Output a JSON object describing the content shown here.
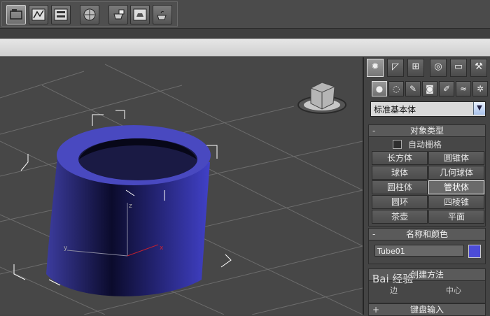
{
  "toolbar": {
    "buttons": [
      "layer-manager",
      "curve-editor",
      "render-to-texture",
      "material-editor",
      "render-setup",
      "rendered-frame-window",
      "render-production"
    ]
  },
  "panel": {
    "tabs": [
      "create",
      "modify",
      "hierarchy",
      "motion",
      "display",
      "utilities"
    ],
    "category_icons": [
      "geometry",
      "shapes",
      "lights",
      "cameras",
      "helpers",
      "space-warps",
      "systems"
    ],
    "dropdown_value": "标准基本体",
    "object_type": {
      "title": "对象类型",
      "sign": "-",
      "autogrid_label": "自动栅格",
      "buttons": [
        "长方体",
        "圆锥体",
        "球体",
        "几何球体",
        "圆柱体",
        "管状体",
        "圆环",
        "四棱锥",
        "茶壶",
        "平面"
      ],
      "active": "管状体"
    },
    "name_color": {
      "title": "名称和颜色",
      "sign": "-",
      "name_value": "Tube01",
      "color": "#4c4cd8"
    },
    "creation_method": {
      "title": "创建方法",
      "sign": "-",
      "options": [
        "边",
        "中心"
      ]
    },
    "keyboard_entry": {
      "title": "键盘输入",
      "sign": "+"
    }
  },
  "viewport": {
    "axis_labels": {
      "x": "x",
      "y": "y",
      "z": "z"
    },
    "object_color": "#3a3aa0",
    "grid_color": "#6a6a6a"
  },
  "watermark": {
    "text": "Bai 经验"
  }
}
